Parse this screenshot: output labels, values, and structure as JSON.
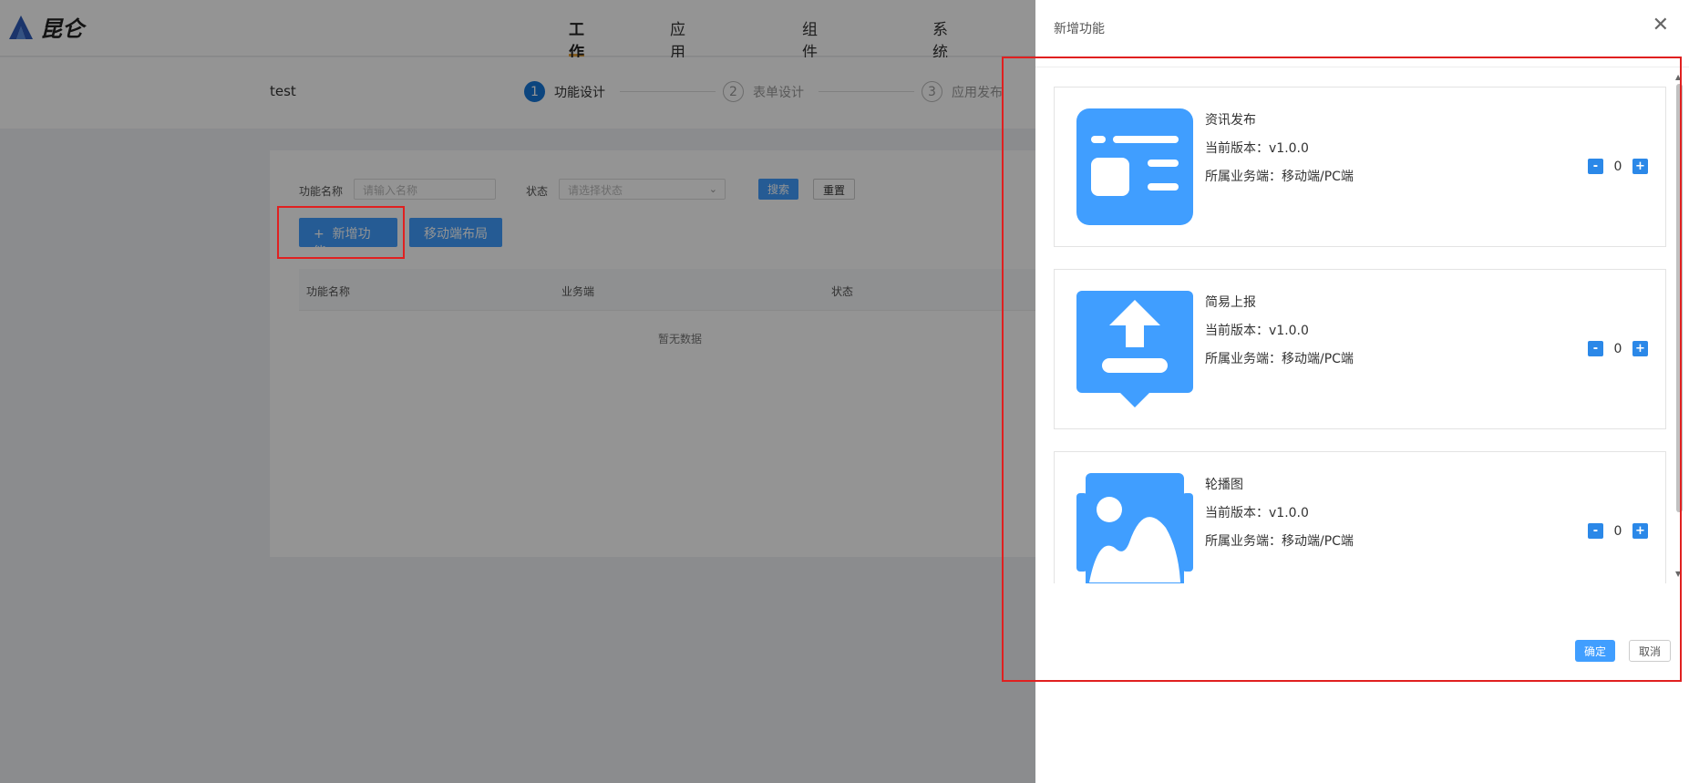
{
  "brand": {
    "name": "昆仑",
    "color": "#2e5bb8"
  },
  "nav": {
    "items": [
      {
        "label": "工作台",
        "active": true
      },
      {
        "label": "应用云商城",
        "active": false
      },
      {
        "label": "组件云商城",
        "active": false
      },
      {
        "label": "系统管理",
        "active": false
      }
    ]
  },
  "app": {
    "name": "test"
  },
  "steps": [
    {
      "num": "1",
      "label": "功能设计",
      "active": true
    },
    {
      "num": "2",
      "label": "表单设计",
      "active": false
    },
    {
      "num": "3",
      "label": "应用发布",
      "active": false
    }
  ],
  "filter": {
    "name_label": "功能名称",
    "name_placeholder": "请输入名称",
    "status_label": "状态",
    "status_placeholder": "请选择状态",
    "search_label": "搜索",
    "reset_label": "重置"
  },
  "actions": {
    "add_label": "新增功能",
    "mobile_layout_label": "移动端布局"
  },
  "table": {
    "headers": [
      "功能名称",
      "业务端",
      "状态"
    ],
    "empty_text": "暂无数据"
  },
  "drawer": {
    "title": "新增功能",
    "items": [
      {
        "name": "资讯发布",
        "version": "当前版本：v1.0.0",
        "biz": "所属业务端：移动端/PC端",
        "count": "0",
        "icon": "news-icon"
      },
      {
        "name": "简易上报",
        "version": "当前版本：v1.0.0",
        "biz": "所属业务端：移动端/PC端",
        "count": "0",
        "icon": "upload-report-icon"
      },
      {
        "name": "轮播图",
        "version": "当前版本：v1.0.0",
        "biz": "所属业务端：移动端/PC端",
        "count": "0",
        "icon": "image-carousel-icon"
      }
    ],
    "ok_label": "确定",
    "cancel_label": "取消"
  },
  "colors": {
    "accent": "#409eff",
    "icon": "#409eff",
    "highlight": "#e02020",
    "active_tab": "#e6a23c"
  }
}
